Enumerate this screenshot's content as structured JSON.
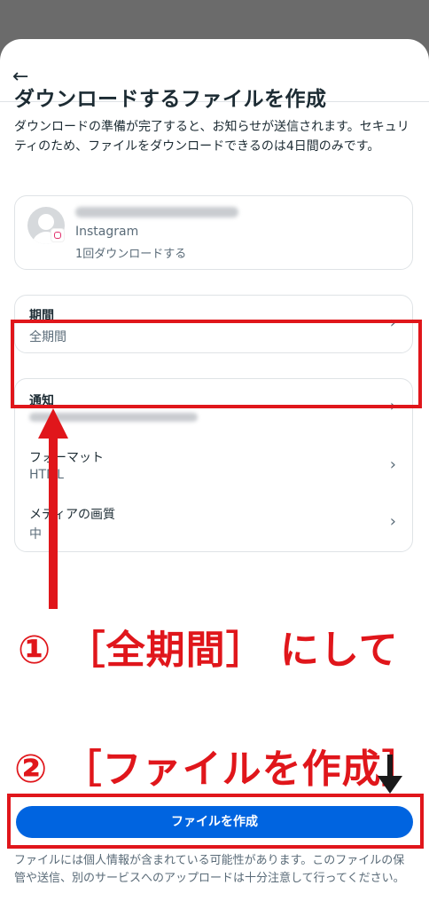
{
  "header": {
    "back_icon": "←"
  },
  "title": "ダウンロードするファイルを作成",
  "description": "ダウンロードの準備が完了すると、お知らせが送信されます。セキュリティのため、ファイルをダウンロードできるのは4日間のみです。",
  "account": {
    "app": "Instagram",
    "download_count": "1回ダウンロードする"
  },
  "period": {
    "label": "期間",
    "value": "全期間"
  },
  "settings": {
    "notify": {
      "label": "通知"
    },
    "format": {
      "label": "フォーマット",
      "value": "HTML"
    },
    "quality": {
      "label": "メディアの画質",
      "value": "中"
    }
  },
  "chevron": "›",
  "annotations": {
    "step1": "① ［全期間］ にして",
    "step2": "② ［ファイルを作成］"
  },
  "cta": {
    "label": "ファイルを作成"
  },
  "footer": "ファイルには個人情報が含まれている可能性があります。このファイルの保管や送信、別のサービスへのアップロードは十分注意して行ってください。",
  "colors": {
    "accent": "#0064e0",
    "annotation": "#e0161b"
  }
}
